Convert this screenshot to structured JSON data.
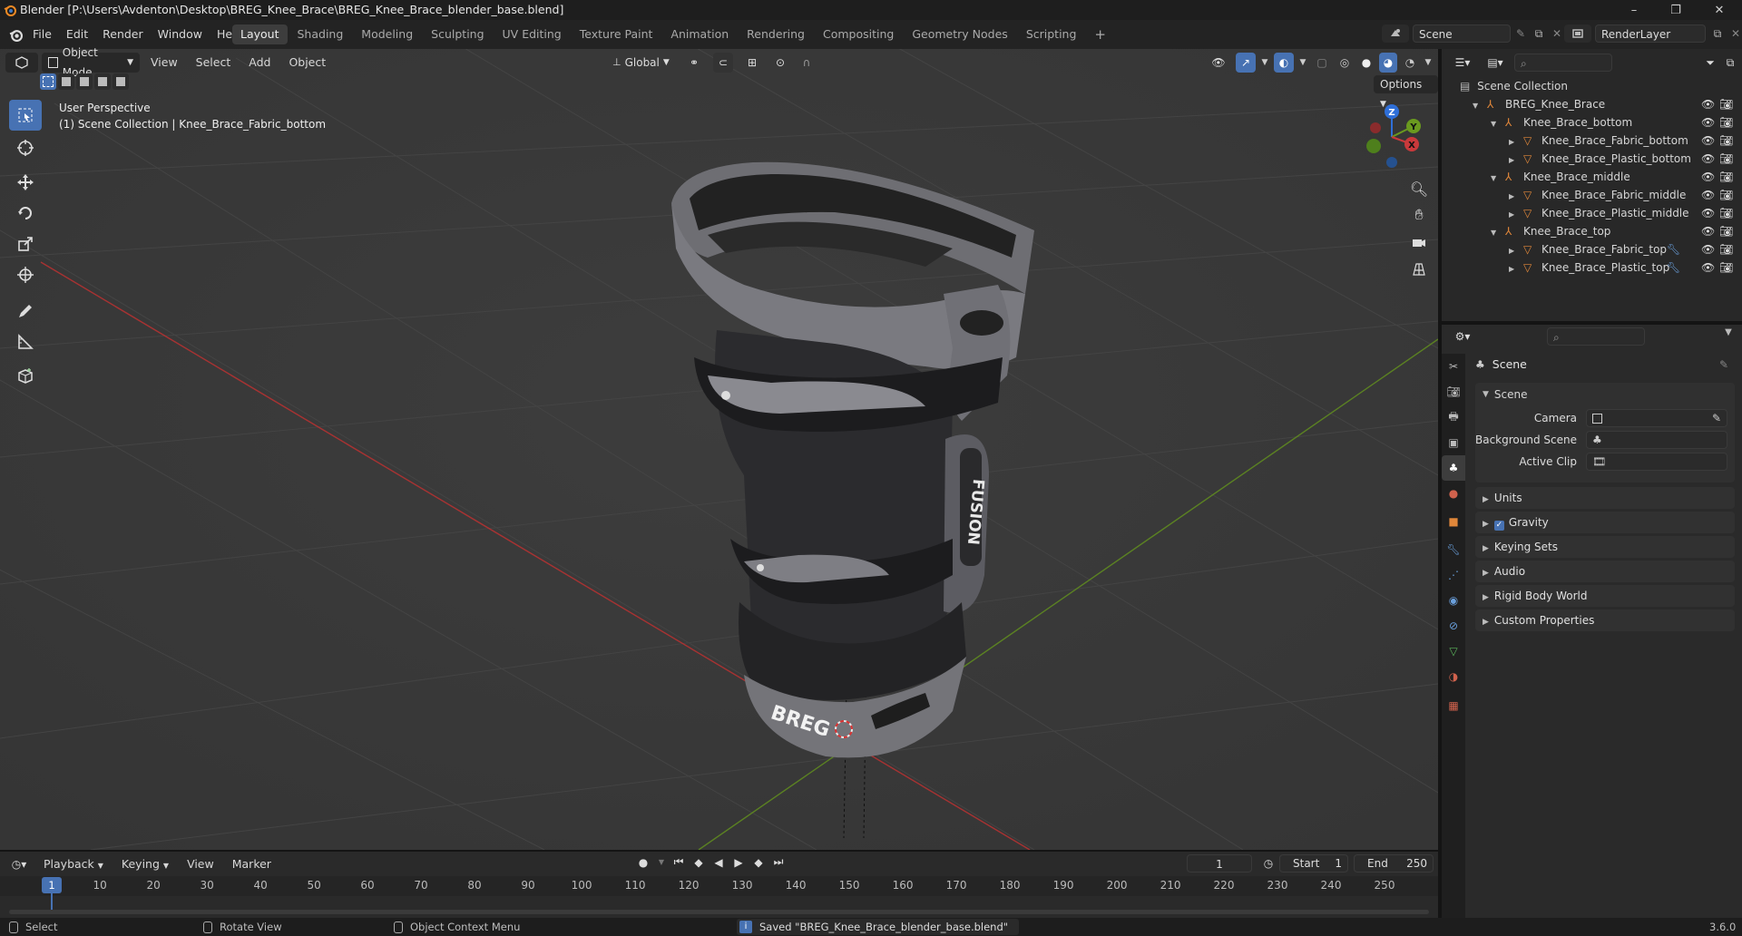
{
  "titlebar": {
    "title": "Blender [P:\\Users\\Avdenton\\Desktop\\BREG_Knee_Brace\\BREG_Knee_Brace_blender_base.blend]",
    "minimize": "–",
    "maximize": "❐",
    "close": "✕"
  },
  "menus": [
    "File",
    "Edit",
    "Render",
    "Window",
    "Help"
  ],
  "workspaces": [
    "Layout",
    "Shading",
    "Modeling",
    "Sculpting",
    "UV Editing",
    "Texture Paint",
    "Animation",
    "Rendering",
    "Compositing",
    "Geometry Nodes",
    "Scripting"
  ],
  "workspace_add": "+",
  "scene_field": "Scene",
  "renderlayer_field": "RenderLayer",
  "viewport": {
    "mode": "Object Mode",
    "menus": [
      "View",
      "Select",
      "Add",
      "Object"
    ],
    "orientation": "Global",
    "options": "Options",
    "info_line1": "User Perspective",
    "info_line2": "(1) Scene Collection | Knee_Brace_Fabric_bottom",
    "gizmo": {
      "x": "X",
      "y": "Y",
      "z": "Z"
    },
    "brand_top": "FUSION",
    "brand_bottom": "BREG"
  },
  "outliner": {
    "root": "Scene Collection",
    "rows": [
      {
        "label": "BREG_Knee_Brace",
        "indent": 0
      },
      {
        "label": "Knee_Brace_bottom",
        "indent": 1
      },
      {
        "label": "Knee_Brace_Fabric_bottom",
        "indent": 2
      },
      {
        "label": "Knee_Brace_Plastic_bottom",
        "indent": 2
      },
      {
        "label": "Knee_Brace_middle",
        "indent": 1
      },
      {
        "label": "Knee_Brace_Fabric_middle",
        "indent": 2
      },
      {
        "label": "Knee_Brace_Plastic_middle",
        "indent": 2
      },
      {
        "label": "Knee_Brace_top",
        "indent": 1
      },
      {
        "label": "Knee_Brace_Fabric_top",
        "indent": 2
      },
      {
        "label": "Knee_Brace_Plastic_top",
        "indent": 2
      }
    ]
  },
  "properties": {
    "context": "Scene",
    "panel_scene": "Scene",
    "camera_label": "Camera",
    "bg_scene_label": "Background Scene",
    "active_clip_label": "Active Clip",
    "panels": [
      "Units",
      "Gravity",
      "Keying Sets",
      "Audio",
      "Rigid Body World",
      "Custom Properties"
    ]
  },
  "timeline": {
    "menus": [
      "Playback",
      "Keying",
      "View",
      "Marker"
    ],
    "current_frame": "1",
    "start_label": "Start",
    "start": "1",
    "end_label": "End",
    "end": "250",
    "ruler": [
      "1",
      "10",
      "20",
      "30",
      "40",
      "50",
      "60",
      "70",
      "80",
      "90",
      "100",
      "110",
      "120",
      "130",
      "140",
      "150",
      "160",
      "170",
      "180",
      "190",
      "200",
      "210",
      "220",
      "230",
      "240",
      "250"
    ]
  },
  "status": {
    "select": "Select",
    "rotate": "Rotate View",
    "context_menu": "Object Context Menu",
    "message": "Saved \"BREG_Knee_Brace_blender_base.blend\"",
    "version": "3.6.0"
  },
  "colors": {
    "accent": "#4772b3",
    "x_axis": "#c9393b",
    "y_axis": "#6a9a1f",
    "z_axis": "#2f6fd8",
    "orange": "#e0873a"
  }
}
